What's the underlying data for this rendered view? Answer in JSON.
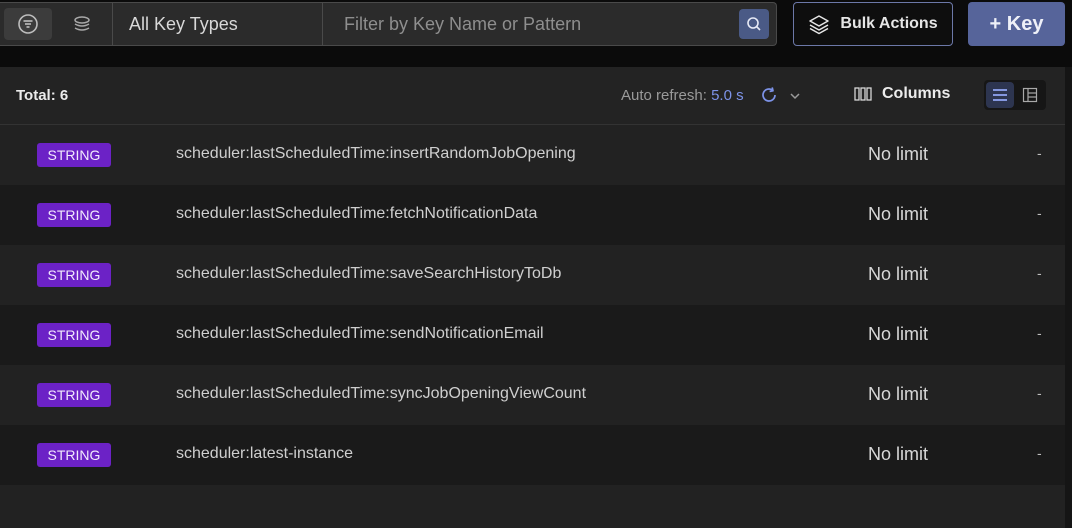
{
  "toolbar": {
    "list_mode_icon": "filter-list-icon",
    "tree_mode_icon": "tree-view-icon",
    "key_type_select": "All Key Types",
    "filter_placeholder": "Filter by Key Name or Pattern",
    "search_icon": "search-icon",
    "bulk_actions_label": "Bulk Actions",
    "bulk_actions_icon": "layers-icon",
    "add_key_label": "+ Key"
  },
  "header": {
    "total": "Total: 6",
    "auto_refresh_label": "Auto refresh:",
    "auto_refresh_value": "5.0 s",
    "refresh_icon": "refresh-icon",
    "columns_label": "Columns",
    "columns_icon": "columns-icon",
    "list_view_icon": "list-view-icon",
    "grid_view_icon": "tree-grid-icon"
  },
  "rows": [
    {
      "type": "STRING",
      "name": "scheduler:lastScheduledTime:insertRandomJobOpening",
      "ttl": "No limit",
      "size": "-"
    },
    {
      "type": "STRING",
      "name": "scheduler:lastScheduledTime:fetchNotificationData",
      "ttl": "No limit",
      "size": "-"
    },
    {
      "type": "STRING",
      "name": "scheduler:lastScheduledTime:saveSearchHistoryToDb",
      "ttl": "No limit",
      "size": "-"
    },
    {
      "type": "STRING",
      "name": "scheduler:lastScheduledTime:sendNotificationEmail",
      "ttl": "No limit",
      "size": "-"
    },
    {
      "type": "STRING",
      "name": "scheduler:lastScheduledTime:syncJobOpeningViewCount",
      "ttl": "No limit",
      "size": "-"
    },
    {
      "type": "STRING",
      "name": "scheduler:latest-instance",
      "ttl": "No limit",
      "size": "-"
    }
  ],
  "colors": {
    "string_badge": "#6c22c6",
    "accent": "#56649a",
    "refresh_value": "#7d93e8"
  }
}
